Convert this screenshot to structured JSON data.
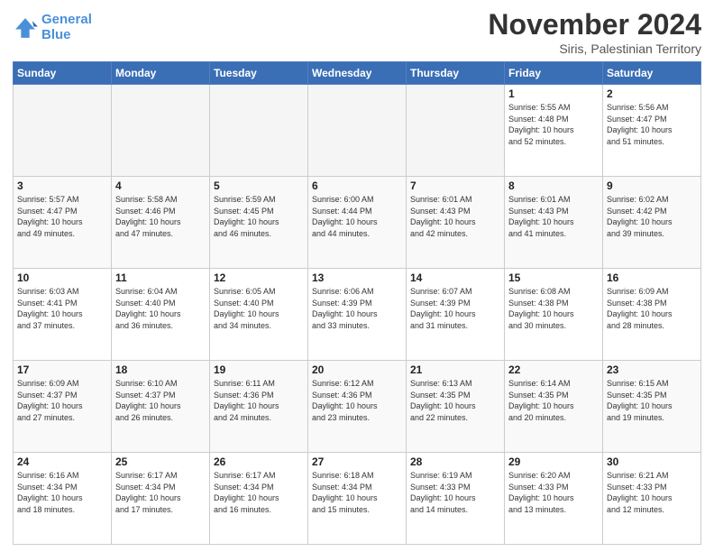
{
  "logo": {
    "line1": "General",
    "line2": "Blue"
  },
  "header": {
    "month": "November 2024",
    "location": "Siris, Palestinian Territory"
  },
  "weekdays": [
    "Sunday",
    "Monday",
    "Tuesday",
    "Wednesday",
    "Thursday",
    "Friday",
    "Saturday"
  ],
  "weeks": [
    [
      {
        "day": "",
        "info": ""
      },
      {
        "day": "",
        "info": ""
      },
      {
        "day": "",
        "info": ""
      },
      {
        "day": "",
        "info": ""
      },
      {
        "day": "",
        "info": ""
      },
      {
        "day": "1",
        "info": "Sunrise: 5:55 AM\nSunset: 4:48 PM\nDaylight: 10 hours\nand 52 minutes."
      },
      {
        "day": "2",
        "info": "Sunrise: 5:56 AM\nSunset: 4:47 PM\nDaylight: 10 hours\nand 51 minutes."
      }
    ],
    [
      {
        "day": "3",
        "info": "Sunrise: 5:57 AM\nSunset: 4:47 PM\nDaylight: 10 hours\nand 49 minutes."
      },
      {
        "day": "4",
        "info": "Sunrise: 5:58 AM\nSunset: 4:46 PM\nDaylight: 10 hours\nand 47 minutes."
      },
      {
        "day": "5",
        "info": "Sunrise: 5:59 AM\nSunset: 4:45 PM\nDaylight: 10 hours\nand 46 minutes."
      },
      {
        "day": "6",
        "info": "Sunrise: 6:00 AM\nSunset: 4:44 PM\nDaylight: 10 hours\nand 44 minutes."
      },
      {
        "day": "7",
        "info": "Sunrise: 6:01 AM\nSunset: 4:43 PM\nDaylight: 10 hours\nand 42 minutes."
      },
      {
        "day": "8",
        "info": "Sunrise: 6:01 AM\nSunset: 4:43 PM\nDaylight: 10 hours\nand 41 minutes."
      },
      {
        "day": "9",
        "info": "Sunrise: 6:02 AM\nSunset: 4:42 PM\nDaylight: 10 hours\nand 39 minutes."
      }
    ],
    [
      {
        "day": "10",
        "info": "Sunrise: 6:03 AM\nSunset: 4:41 PM\nDaylight: 10 hours\nand 37 minutes."
      },
      {
        "day": "11",
        "info": "Sunrise: 6:04 AM\nSunset: 4:40 PM\nDaylight: 10 hours\nand 36 minutes."
      },
      {
        "day": "12",
        "info": "Sunrise: 6:05 AM\nSunset: 4:40 PM\nDaylight: 10 hours\nand 34 minutes."
      },
      {
        "day": "13",
        "info": "Sunrise: 6:06 AM\nSunset: 4:39 PM\nDaylight: 10 hours\nand 33 minutes."
      },
      {
        "day": "14",
        "info": "Sunrise: 6:07 AM\nSunset: 4:39 PM\nDaylight: 10 hours\nand 31 minutes."
      },
      {
        "day": "15",
        "info": "Sunrise: 6:08 AM\nSunset: 4:38 PM\nDaylight: 10 hours\nand 30 minutes."
      },
      {
        "day": "16",
        "info": "Sunrise: 6:09 AM\nSunset: 4:38 PM\nDaylight: 10 hours\nand 28 minutes."
      }
    ],
    [
      {
        "day": "17",
        "info": "Sunrise: 6:09 AM\nSunset: 4:37 PM\nDaylight: 10 hours\nand 27 minutes."
      },
      {
        "day": "18",
        "info": "Sunrise: 6:10 AM\nSunset: 4:37 PM\nDaylight: 10 hours\nand 26 minutes."
      },
      {
        "day": "19",
        "info": "Sunrise: 6:11 AM\nSunset: 4:36 PM\nDaylight: 10 hours\nand 24 minutes."
      },
      {
        "day": "20",
        "info": "Sunrise: 6:12 AM\nSunset: 4:36 PM\nDaylight: 10 hours\nand 23 minutes."
      },
      {
        "day": "21",
        "info": "Sunrise: 6:13 AM\nSunset: 4:35 PM\nDaylight: 10 hours\nand 22 minutes."
      },
      {
        "day": "22",
        "info": "Sunrise: 6:14 AM\nSunset: 4:35 PM\nDaylight: 10 hours\nand 20 minutes."
      },
      {
        "day": "23",
        "info": "Sunrise: 6:15 AM\nSunset: 4:35 PM\nDaylight: 10 hours\nand 19 minutes."
      }
    ],
    [
      {
        "day": "24",
        "info": "Sunrise: 6:16 AM\nSunset: 4:34 PM\nDaylight: 10 hours\nand 18 minutes."
      },
      {
        "day": "25",
        "info": "Sunrise: 6:17 AM\nSunset: 4:34 PM\nDaylight: 10 hours\nand 17 minutes."
      },
      {
        "day": "26",
        "info": "Sunrise: 6:17 AM\nSunset: 4:34 PM\nDaylight: 10 hours\nand 16 minutes."
      },
      {
        "day": "27",
        "info": "Sunrise: 6:18 AM\nSunset: 4:34 PM\nDaylight: 10 hours\nand 15 minutes."
      },
      {
        "day": "28",
        "info": "Sunrise: 6:19 AM\nSunset: 4:33 PM\nDaylight: 10 hours\nand 14 minutes."
      },
      {
        "day": "29",
        "info": "Sunrise: 6:20 AM\nSunset: 4:33 PM\nDaylight: 10 hours\nand 13 minutes."
      },
      {
        "day": "30",
        "info": "Sunrise: 6:21 AM\nSunset: 4:33 PM\nDaylight: 10 hours\nand 12 minutes."
      }
    ]
  ]
}
